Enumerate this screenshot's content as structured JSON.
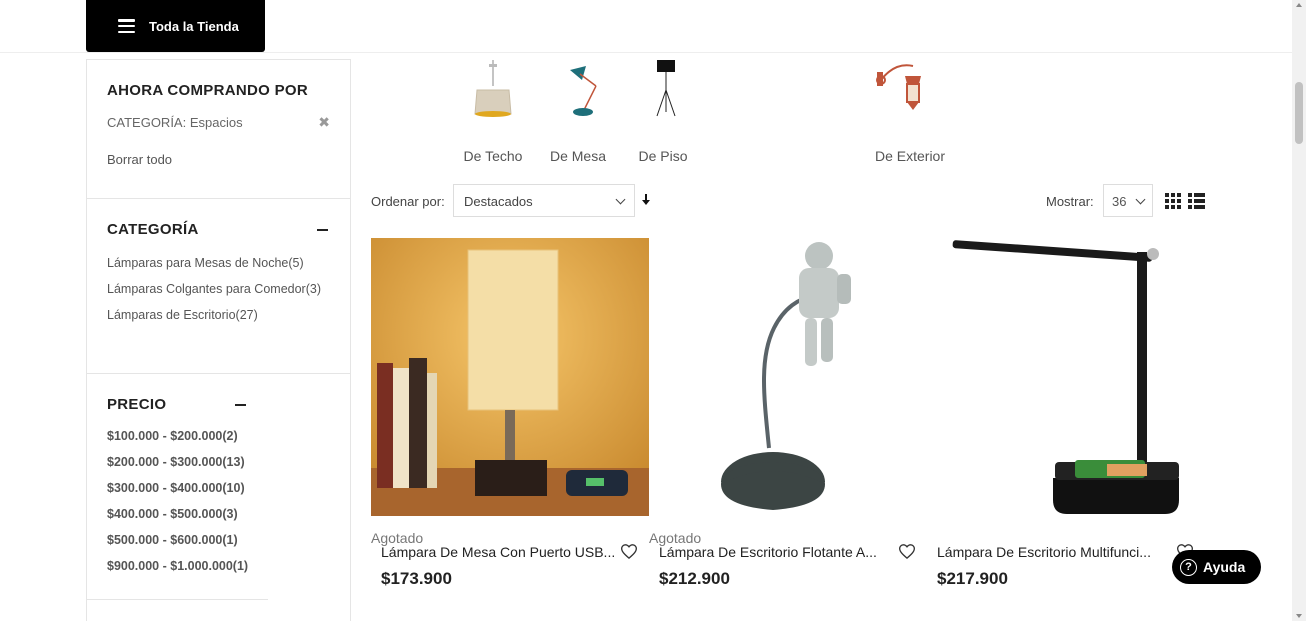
{
  "header": {
    "store_button_label": "Toda la Tienda"
  },
  "sidebar": {
    "now_shopping": {
      "title": "AHORA COMPRANDO POR",
      "active_filter": "CATEGORÍA: Espacios",
      "remove_icon": "✖",
      "clear_all": "Borrar todo"
    },
    "category": {
      "title": "CATEGORÍA",
      "items": [
        "Lámparas para Mesas de Noche(5)",
        "Lámparas Colgantes para Comedor(3)",
        "Lámparas de Escritorio(27)"
      ]
    },
    "price": {
      "title": "PRECIO",
      "items": [
        "$100.000 - $200.000(2)",
        "$200.000 - $300.000(13)",
        "$300.000 - $400.000(10)",
        "$400.000 - $500.000(3)",
        "$500.000 - $600.000(1)",
        "$900.000 - $1.000.000(1)"
      ]
    }
  },
  "categories": [
    {
      "label": "De Techo",
      "icon": "pendant-lamp-icon"
    },
    {
      "label": "De Mesa",
      "icon": "desk-lamp-icon"
    },
    {
      "label": "De Piso",
      "icon": "floor-lamp-icon"
    },
    {
      "label": "De Exterior",
      "icon": "wall-lantern-icon"
    }
  ],
  "toolbar": {
    "sort_label": "Ordenar por:",
    "sort_value": "Destacados",
    "sort_direction_icon": "🠗",
    "show_label": "Mostrar:",
    "show_value": "36"
  },
  "products": [
    {
      "name": "Lámpara De Mesa Con Puerto USB...",
      "price": "$173.900",
      "badge": "Agotado"
    },
    {
      "name": "Lámpara De Escritorio Flotante A...",
      "price": "$212.900",
      "badge": "Agotado"
    },
    {
      "name": "Lámpara De Escritorio Multifunci...",
      "price": "$217.900",
      "badge": ""
    }
  ],
  "help": {
    "label": "Ayuda",
    "icon": "?"
  },
  "colors": {
    "primary": "#000000",
    "accent_lamp": "#1e6f7a",
    "copper": "#c0553a"
  }
}
